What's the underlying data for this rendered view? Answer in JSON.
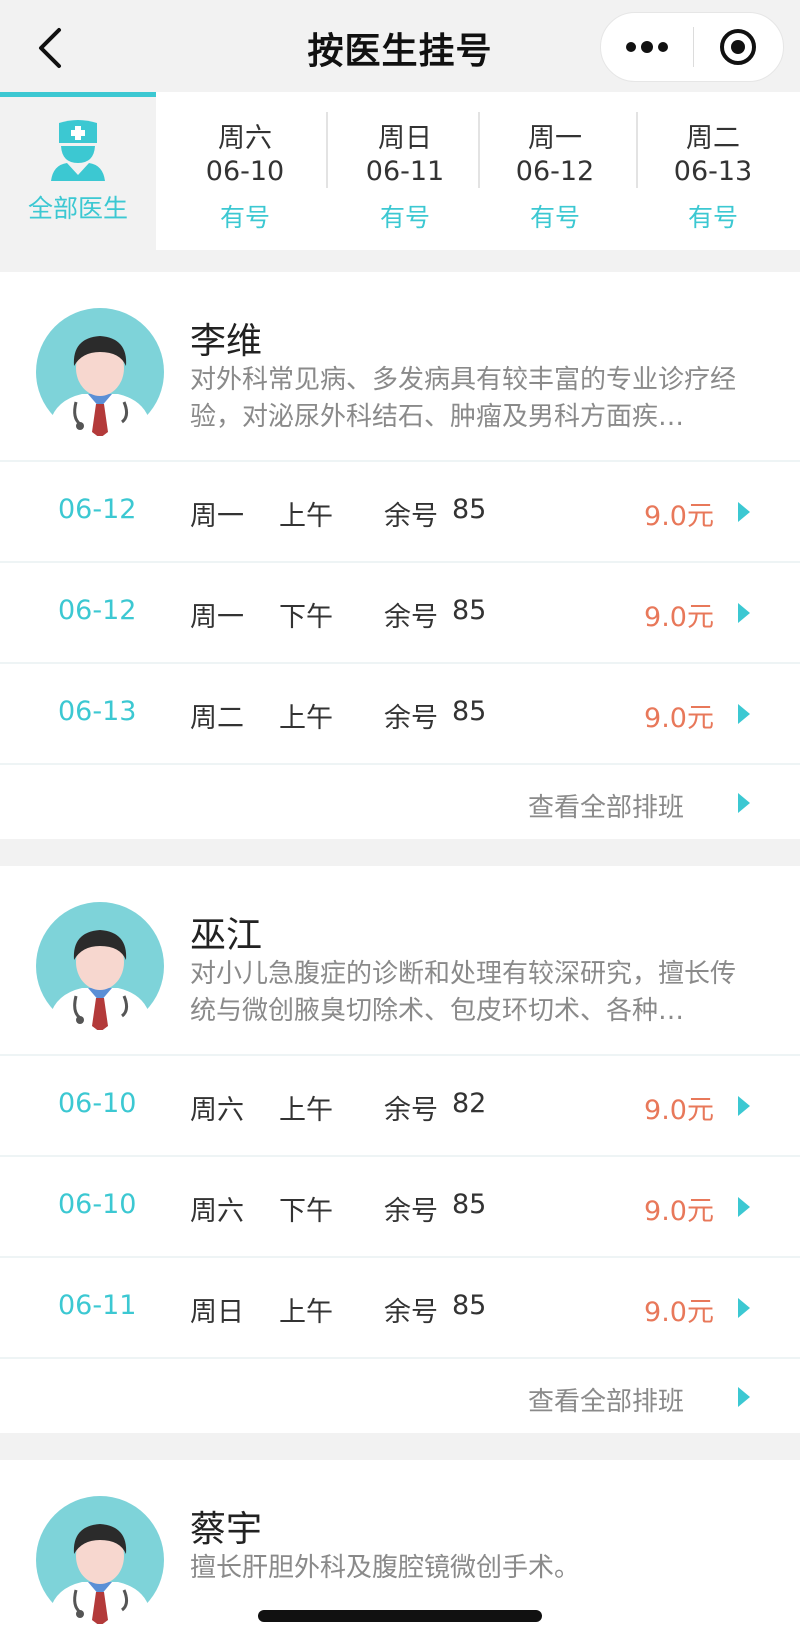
{
  "header": {
    "title": "按医生挂号",
    "back_icon": "chevron-left-icon",
    "more_icon": "more-dots-icon",
    "target_icon": "record-circle-icon"
  },
  "tabs": {
    "all": {
      "label": "全部医生",
      "icon": "doctor-icon"
    },
    "days": [
      {
        "weekday": "周六",
        "date": "06-10",
        "status": "有号"
      },
      {
        "weekday": "周日",
        "date": "06-11",
        "status": "有号"
      },
      {
        "weekday": "周一",
        "date": "06-12",
        "status": "有号"
      },
      {
        "weekday": "周二",
        "date": "06-13",
        "status": "有号"
      }
    ]
  },
  "colors": {
    "accent": "#3cc8d2",
    "price": "#e8785a",
    "text": "#333333",
    "muted": "#8a8a8a"
  },
  "doctors": [
    {
      "name": "李维",
      "desc": "对外科常见病、多发病具有较丰富的专业诊疗经验，对泌尿外科结石、肿瘤及男科方面疾…",
      "slots": [
        {
          "date": "06-12",
          "weekday": "周一",
          "period": "上午",
          "remain_label": "余号",
          "remain": "85",
          "price": "9.0元"
        },
        {
          "date": "06-12",
          "weekday": "周一",
          "period": "下午",
          "remain_label": "余号",
          "remain": "85",
          "price": "9.0元"
        },
        {
          "date": "06-13",
          "weekday": "周二",
          "period": "上午",
          "remain_label": "余号",
          "remain": "85",
          "price": "9.0元"
        }
      ],
      "view_all": "查看全部排班"
    },
    {
      "name": "巫江",
      "desc": "对小儿急腹症的诊断和处理有较深研究，擅长传统与微创腋臭切除术、包皮环切术、各种…",
      "slots": [
        {
          "date": "06-10",
          "weekday": "周六",
          "period": "上午",
          "remain_label": "余号",
          "remain": "82",
          "price": "9.0元"
        },
        {
          "date": "06-10",
          "weekday": "周六",
          "period": "下午",
          "remain_label": "余号",
          "remain": "85",
          "price": "9.0元"
        },
        {
          "date": "06-11",
          "weekday": "周日",
          "period": "上午",
          "remain_label": "余号",
          "remain": "85",
          "price": "9.0元"
        }
      ],
      "view_all": "查看全部排班"
    },
    {
      "name": "蔡宇",
      "desc": "擅长肝胆外科及腹腔镜微创手术。"
    }
  ]
}
